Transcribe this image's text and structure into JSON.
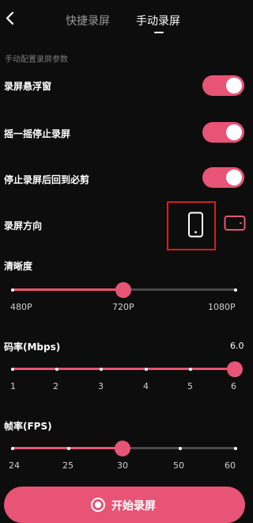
{
  "header": {
    "back_icon": "chevron-left-icon",
    "tabs": [
      {
        "label": "快捷录屏",
        "active": false
      },
      {
        "label": "手动录屏",
        "active": true
      }
    ]
  },
  "section_title": "手动配置录屏参数",
  "toggles": [
    {
      "label": "录屏悬浮窗",
      "on": true
    },
    {
      "label": "摇一摇停止录屏",
      "on": true
    },
    {
      "label": "停止录屏后回到必剪",
      "on": true
    }
  ],
  "orientation": {
    "label": "录屏方向",
    "options": [
      "portrait-phone-icon",
      "landscape-phone-icon"
    ],
    "selected": "portrait-phone-icon"
  },
  "resolution": {
    "label": "清晰度",
    "ticks": [
      "480P",
      "720P",
      "1080P"
    ],
    "selected_index": 1
  },
  "bitrate": {
    "label": "码率(Mbps)",
    "value": "6.0",
    "ticks": [
      "1",
      "2",
      "3",
      "4",
      "5",
      "6"
    ],
    "selected_index": 5
  },
  "framerate": {
    "label": "帧率(FPS)",
    "ticks": [
      "24",
      "25",
      "30",
      "50",
      "60"
    ],
    "selected_index": 2
  },
  "start_button": {
    "label": "开始录屏",
    "icon": "record-icon"
  },
  "colors": {
    "accent": "#e75475",
    "background": "#0d0d0d",
    "highlight_box": "#cc2222"
  }
}
